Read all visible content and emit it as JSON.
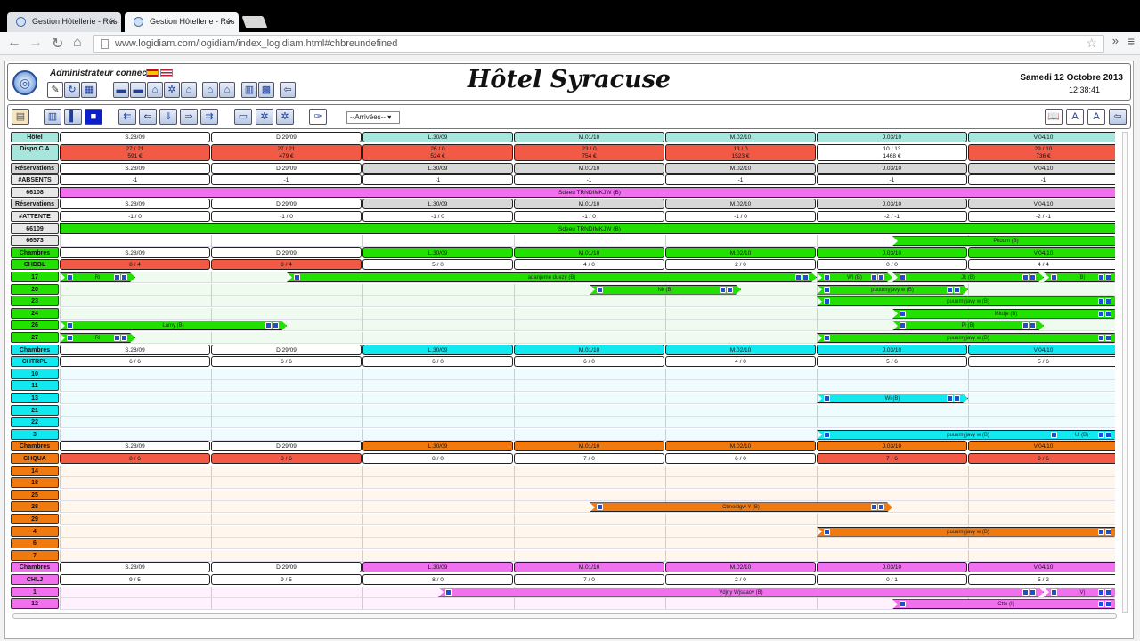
{
  "browser": {
    "tabs": [
      {
        "label": "Gestion Hôtellerie - Rés"
      },
      {
        "label": "Gestion Hôtellerie - Rés"
      }
    ],
    "url": "www.logidiam.com/logidiam/index_logidiam.html#chbreundefined"
  },
  "header": {
    "admin": "Administrateur connecté",
    "title": "Hôtel Syracuse",
    "date": "Samedi 12 Octobre 2013",
    "time": "12:38:41"
  },
  "toolbar": {
    "select_value": "--Arrivées--"
  },
  "days": [
    "S.28/09",
    "D.29/09",
    "L.30/09",
    "M.01/10",
    "M.02/10",
    "J.03/10",
    "V.04/10"
  ],
  "colors": {
    "green": "#22e000",
    "cyan": "#12e8f0",
    "orange": "#f07a10",
    "pink": "#f070ee",
    "red": "#f35a45",
    "grey": "#d8d8d8",
    "teal": "#a6e6dc"
  },
  "sections": {
    "top": [
      {
        "label": "Hôtel",
        "type": "days"
      },
      {
        "label": "Dispo C.A",
        "type": "dispo",
        "cells": [
          [
            "27 / 21",
            "591 €"
          ],
          [
            "27 / 21",
            "479 €"
          ],
          [
            "26 / 0",
            "524 €"
          ],
          [
            "23 / 0",
            "754 €"
          ],
          [
            "13 / 0",
            "1523 €"
          ],
          [
            "10 / 13",
            "1468 €"
          ],
          [
            "29 / 10",
            "736 €"
          ]
        ]
      },
      {
        "label": "Réservations",
        "type": "days"
      },
      {
        "label": "#ABSENTS",
        "type": "vals",
        "cells": [
          "-1",
          "-1",
          "-1",
          "-1",
          "-1",
          "-1",
          "-1"
        ]
      },
      {
        "label": "66108",
        "type": "bar",
        "bar": "Sdeeu TRNDIMKJW (B)"
      },
      {
        "label": "Réservations",
        "type": "days"
      },
      {
        "label": "#ATTENTE",
        "type": "vals",
        "cells": [
          "-1 / 0",
          "-1 / 0",
          "-1 / 0",
          "-1 / 0",
          "-1 / 0",
          "-2 / -1",
          "-2 / -1"
        ]
      },
      {
        "label": "66109",
        "type": "bar",
        "bar": "Sdeeu TRNDIMKJW (B)"
      },
      {
        "label": "66573",
        "type": "bar2",
        "bar": "Pkoum (B)"
      }
    ],
    "cats": [
      {
        "name": "Chambres",
        "code": "CHDBL",
        "color": "green",
        "counts": [
          "8 / 4",
          "8 / 4",
          "5 / 0",
          "4 / 0",
          "2 / 0",
          "0 / 0",
          "4 / 4"
        ],
        "rooms": [
          "17",
          "20",
          "23",
          "24",
          "26",
          "27"
        ]
      },
      {
        "name": "Chambres",
        "code": "CHTRPL",
        "color": "cyan",
        "counts": [
          "6 / 6",
          "6 / 6",
          "6 / 0",
          "6 / 0",
          "4 / 0",
          "5 / 6",
          "5 / 6"
        ],
        "rooms": [
          "10",
          "11",
          "13",
          "21",
          "22",
          "3"
        ]
      },
      {
        "name": "Chambres",
        "code": "CHQUA",
        "color": "orange",
        "counts": [
          "8 / 6",
          "8 / 6",
          "8 / 0",
          "7 / 0",
          "6 / 0",
          "7 / 6",
          "8 / 6"
        ],
        "rooms": [
          "14",
          "18",
          "25",
          "28",
          "29",
          "4",
          "6",
          "7"
        ]
      },
      {
        "name": "Chambres",
        "code": "CHLJ",
        "color": "pink",
        "counts": [
          "9 / 5",
          "9 / 5",
          "8 / 0",
          "7 / 0",
          "2 / 0",
          "0 / 1",
          "5 / 2"
        ],
        "rooms": [
          "1",
          "12"
        ]
      }
    ],
    "bars": [
      {
        "room": "17",
        "label": "Ri",
        "start": 0,
        "len": 0.5
      },
      {
        "room": "17",
        "label": "adanjeme duezy (B)",
        "start": 1.5,
        "len": 3.5
      },
      {
        "room": "17",
        "label": "Wl (B)",
        "start": 5,
        "len": 0.5
      },
      {
        "room": "17",
        "label": "Jk (B)",
        "start": 5.5,
        "len": 1
      },
      {
        "room": "17",
        "label": "(B)",
        "start": 6.5,
        "len": 0.5
      },
      {
        "room": "20",
        "label": "Nk (B)",
        "start": 3.5,
        "len": 1
      },
      {
        "room": "20",
        "label": "puuumyjavy w (B)",
        "start": 5,
        "len": 1
      },
      {
        "room": "23",
        "label": "puuumyjavy w (B)",
        "start": 5,
        "len": 2
      },
      {
        "room": "24",
        "label": "Mltdje (B)",
        "start": 5.5,
        "len": 1.5
      },
      {
        "room": "26",
        "label": "Lamy (B)",
        "start": 0,
        "len": 1.5
      },
      {
        "room": "26",
        "label": "Pi (B)",
        "start": 5.5,
        "len": 1
      },
      {
        "room": "27",
        "label": "Ri",
        "start": 0,
        "len": 0.5
      },
      {
        "room": "27",
        "label": "puuumyjavy w (B)",
        "start": 5,
        "len": 2
      },
      {
        "room": "13",
        "label": "Wi (B)",
        "start": 5,
        "len": 1
      },
      {
        "room": "3",
        "label": "puuumyjavy w (B)",
        "start": 5,
        "len": 2
      },
      {
        "room": "3",
        "label": "Ui (B)",
        "start": 6.5,
        "len": 0.5
      },
      {
        "room": "28",
        "label": "Ctmeidgw Y (B)",
        "start": 3.5,
        "len": 2
      },
      {
        "room": "4",
        "label": "puuumyjavy w (B)",
        "start": 5,
        "len": 2
      },
      {
        "room": "1",
        "label": "Vdjny Wjsaaov (B)",
        "start": 2.5,
        "len": 4
      },
      {
        "room": "1",
        "label": "(V)",
        "start": 6.5,
        "len": 0.5
      },
      {
        "room": "12",
        "label": "Ctto (I)",
        "start": 5.5,
        "len": 1.5
      }
    ]
  }
}
